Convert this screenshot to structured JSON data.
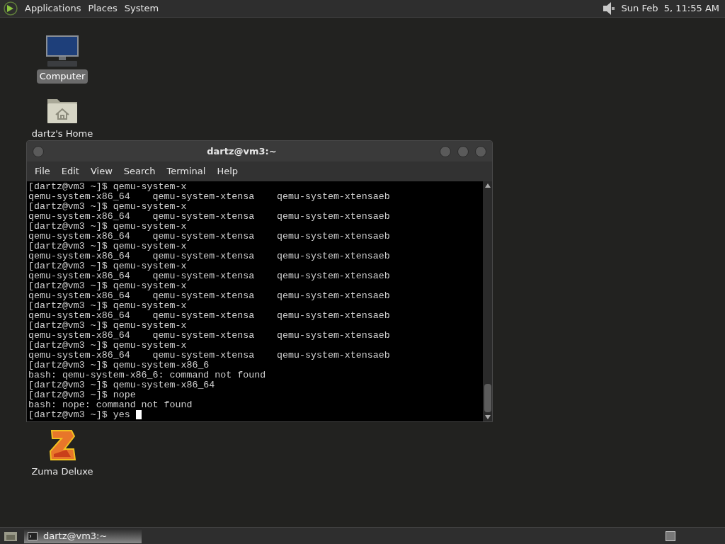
{
  "top_panel": {
    "menus": [
      "Applications",
      "Places",
      "System"
    ],
    "clock": "Sun Feb  5, 11:55 AM"
  },
  "desktop_icons": [
    {
      "kind": "computer",
      "label": "Computer",
      "selected": true
    },
    {
      "kind": "home",
      "label": "dartz's Home",
      "selected": false
    },
    {
      "kind": "game",
      "label": "Zuma Deluxe",
      "selected": false
    }
  ],
  "terminal_window": {
    "title": "dartz@vm3:~",
    "menu": [
      "File",
      "Edit",
      "View",
      "Search",
      "Terminal",
      "Help"
    ],
    "lines": [
      "[dartz@vm3 ~]$ qemu-system-x",
      "qemu-system-x86_64    qemu-system-xtensa    qemu-system-xtensaeb",
      "[dartz@vm3 ~]$ qemu-system-x",
      "qemu-system-x86_64    qemu-system-xtensa    qemu-system-xtensaeb",
      "[dartz@vm3 ~]$ qemu-system-x",
      "qemu-system-x86_64    qemu-system-xtensa    qemu-system-xtensaeb",
      "[dartz@vm3 ~]$ qemu-system-x",
      "qemu-system-x86_64    qemu-system-xtensa    qemu-system-xtensaeb",
      "[dartz@vm3 ~]$ qemu-system-x",
      "qemu-system-x86_64    qemu-system-xtensa    qemu-system-xtensaeb",
      "[dartz@vm3 ~]$ qemu-system-x",
      "qemu-system-x86_64    qemu-system-xtensa    qemu-system-xtensaeb",
      "[dartz@vm3 ~]$ qemu-system-x",
      "qemu-system-x86_64    qemu-system-xtensa    qemu-system-xtensaeb",
      "[dartz@vm3 ~]$ qemu-system-x",
      "qemu-system-x86_64    qemu-system-xtensa    qemu-system-xtensaeb",
      "[dartz@vm3 ~]$ qemu-system-x",
      "qemu-system-x86_64    qemu-system-xtensa    qemu-system-xtensaeb",
      "[dartz@vm3 ~]$ qemu-system-x86_6",
      "bash: qemu-system-x86_6: command not found",
      "[dartz@vm3 ~]$ qemu-system-x86_64",
      "[dartz@vm3 ~]$ nope",
      "bash: nope: command not found",
      "[dartz@vm3 ~]$ yes "
    ]
  },
  "taskbar": {
    "items": [
      {
        "label": "dartz@vm3:~",
        "selected": true
      }
    ]
  }
}
